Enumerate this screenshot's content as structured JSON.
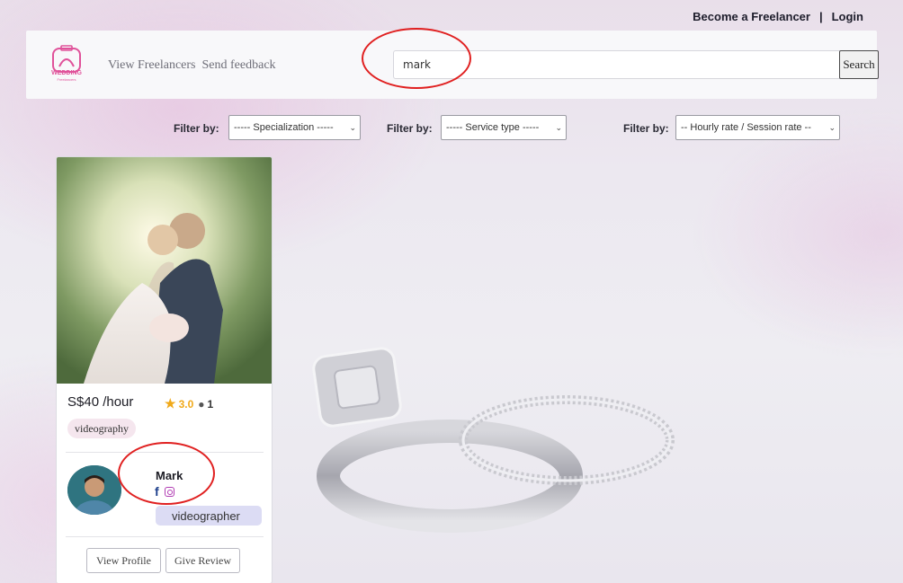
{
  "top_links": {
    "become_freelancer": "Become a Freelancer",
    "separator": "|",
    "login": "Login"
  },
  "navbar": {
    "logo_text": "WEDDING",
    "logo_subtext": "Freelancers",
    "links": [
      "View Freelancers",
      "Send feedback"
    ],
    "search": {
      "value": "mark",
      "button_label": "Search"
    }
  },
  "filters": [
    {
      "label": "Filter by:",
      "selected": "----- Specialization -----"
    },
    {
      "label": "Filter by:",
      "selected": "----- Service type -----"
    },
    {
      "label": "Filter by:",
      "selected": "-- Hourly rate / Session rate --"
    }
  ],
  "freelancer_card": {
    "price": "S$40 /hour",
    "rating": "3.0",
    "review_count": "1",
    "service_tag": "videography",
    "name": "Mark",
    "role": "videographer",
    "buttons": {
      "view_profile": "View Profile",
      "give_review": "Give Review"
    }
  },
  "icons": {
    "rating": "star-icon",
    "reviews": "comment-icon",
    "facebook": "facebook-icon",
    "instagram": "instagram-icon"
  },
  "colors": {
    "annotation": "#e02020",
    "star": "#f0a91a",
    "logo": "#e0529a",
    "facebook": "#1d3f8c",
    "instagram": "#b13cb3"
  }
}
